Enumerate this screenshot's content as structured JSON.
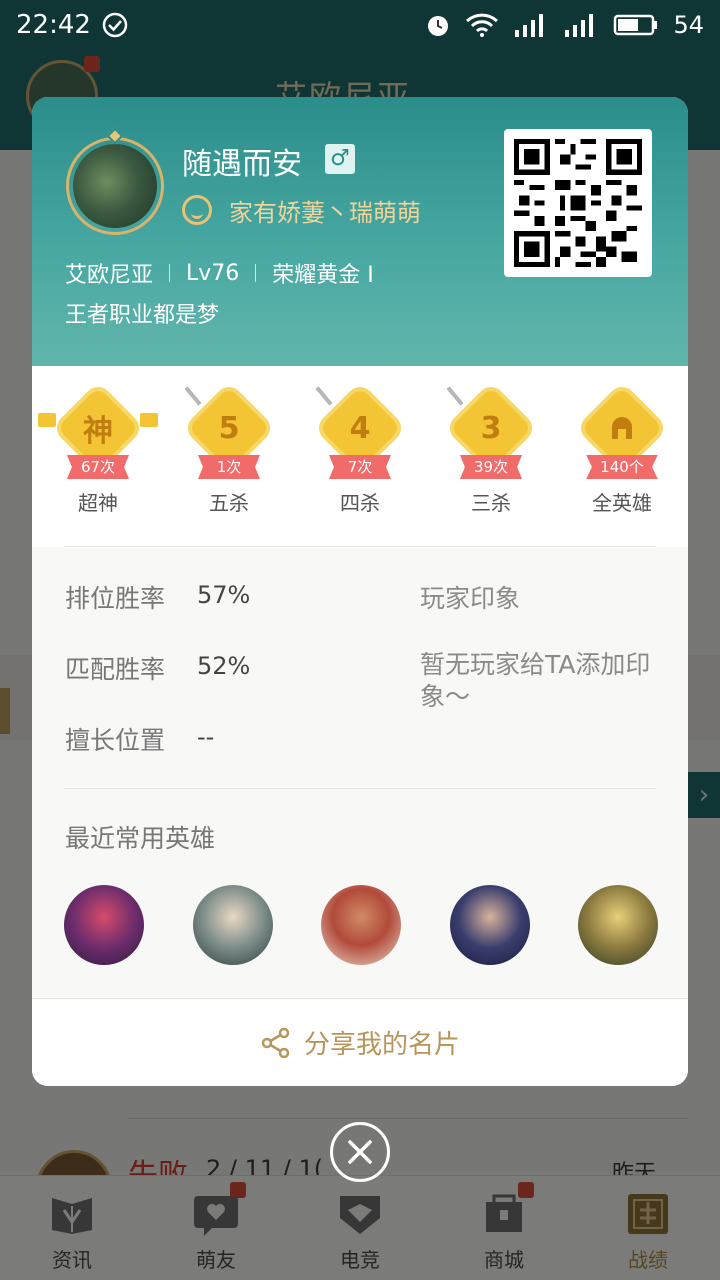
{
  "status_bar": {
    "time": "22:42",
    "battery": "54"
  },
  "background": {
    "title": "艾欧尼亚",
    "match": {
      "result": "失败",
      "kda": "2 / 11 / 1(",
      "time": "昨天"
    }
  },
  "tabbar": [
    {
      "label": "资讯",
      "icon": "news-icon",
      "badge": false
    },
    {
      "label": "萌友",
      "icon": "friends-icon",
      "badge": true
    },
    {
      "label": "电竞",
      "icon": "esports-icon",
      "badge": false
    },
    {
      "label": "商城",
      "icon": "shop-icon",
      "badge": true
    },
    {
      "label": "战绩",
      "icon": "record-icon",
      "badge": false,
      "active": true
    }
  ],
  "card": {
    "nickname": "随遇而安",
    "gender_symbol": "♂",
    "couple": "家有娇萋丶瑞萌萌",
    "server": "艾欧尼亚",
    "level": "Lv76",
    "rank": "荣耀黄金 I",
    "motto": "王者职业都是梦",
    "achievements": [
      {
        "badge": "神",
        "count": "67次",
        "label": "超神"
      },
      {
        "badge": "5",
        "count": "1次",
        "label": "五杀"
      },
      {
        "badge": "4",
        "count": "7次",
        "label": "四杀"
      },
      {
        "badge": "3",
        "count": "39次",
        "label": "三杀"
      },
      {
        "badge": "",
        "count": "140个",
        "label": "全英雄"
      }
    ],
    "stats": {
      "ranked_label": "排位胜率",
      "ranked_value": "57%",
      "match_label": "匹配胜率",
      "match_value": "52%",
      "position_label": "擅长位置",
      "position_value": "--"
    },
    "impression": {
      "title": "玩家印象",
      "text": "暂无玩家给TA添加印象～"
    },
    "recent_heroes_title": "最近常用英雄",
    "share_label": "分享我的名片"
  },
  "colors": {
    "header_teal": "#2a8d8a",
    "gold": "#b8955a",
    "ribbon_red": "#f16b6b",
    "badge_yellow": "#f3c535"
  }
}
